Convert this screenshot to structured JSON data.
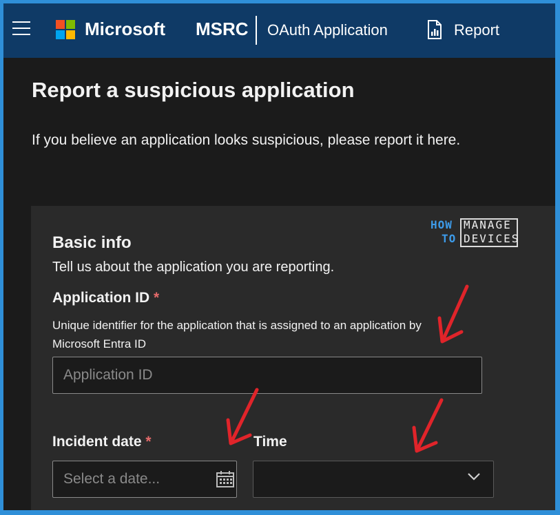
{
  "header": {
    "menu_icon": "hamburger-icon",
    "logo_icon": "microsoft-logo-icon",
    "brand": "Microsoft",
    "product": "MSRC",
    "breadcrumb": "OAuth Application",
    "report_icon": "report-document-icon",
    "report_label": "Report",
    "colors": {
      "background": "#0f3a66",
      "text": "#ffffff"
    }
  },
  "page": {
    "title": "Report a suspicious application",
    "intro": "If you believe an application looks suspicious, please report it here."
  },
  "watermark": {
    "how": "HOW",
    "to": "TO",
    "manage": "MANAGE",
    "devices": "DEVICES"
  },
  "form": {
    "section_title": "Basic info",
    "section_desc": "Tell us about the application you are reporting.",
    "application_id": {
      "label": "Application ID",
      "required_mark": "*",
      "help": "Unique identifier for the application that is assigned to an application by Microsoft Entra ID",
      "placeholder": "Application ID",
      "value": ""
    },
    "incident_date": {
      "label": "Incident date",
      "required_mark": "*",
      "placeholder": "Select a date...",
      "icon": "calendar-icon"
    },
    "time": {
      "label": "Time",
      "value": "",
      "icon": "chevron-down-icon"
    }
  },
  "annotations": {
    "arrow_icon": "red-arrow-icon",
    "color": "#e0242a"
  },
  "colors": {
    "frame_border": "#2f8fd8",
    "page_background": "#1b1b1b",
    "card_background": "#2a2a2a",
    "required": "#e46a6a"
  }
}
